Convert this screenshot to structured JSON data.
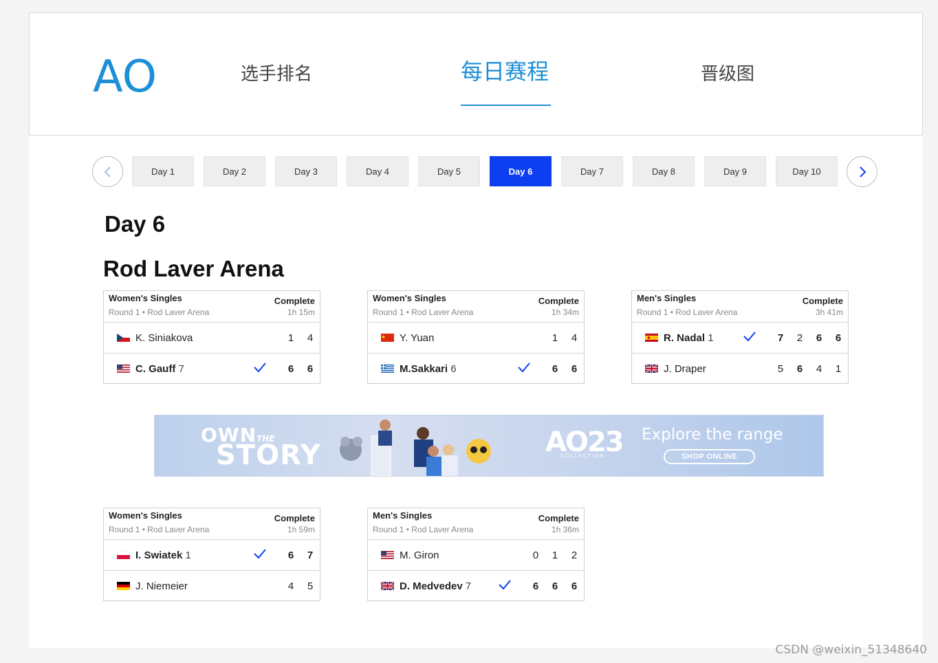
{
  "header": {
    "logo": "AO",
    "tabs": [
      {
        "label": "选手排名",
        "active": false
      },
      {
        "label": "每日赛程",
        "active": true
      },
      {
        "label": "晋级图",
        "active": false
      }
    ]
  },
  "days": {
    "selected": "Day 6",
    "items": [
      "Day 1",
      "Day 2",
      "Day 3",
      "Day 4",
      "Day 5",
      "Day 6",
      "Day 7",
      "Day 8",
      "Day 9",
      "Day 10"
    ]
  },
  "day_title": "Day 6",
  "arena_title": "Rod Laver Arena",
  "matches": [
    {
      "event": "Women's Singles",
      "round": "Round 1 • Rod Laver Arena",
      "status": "Complete",
      "duration": "1h 15m",
      "players": [
        {
          "name": "K. Siniakova",
          "seed": "",
          "flag": "cz",
          "winner": false,
          "scores": [
            "1",
            "4"
          ],
          "won": [
            false,
            false
          ]
        },
        {
          "name": "C. Gauff",
          "seed": "7",
          "flag": "us",
          "winner": true,
          "scores": [
            "6",
            "6"
          ],
          "won": [
            true,
            true
          ]
        }
      ]
    },
    {
      "event": "Women's Singles",
      "round": "Round 1 • Rod Laver Arena",
      "status": "Complete",
      "duration": "1h 34m",
      "players": [
        {
          "name": "Y. Yuan",
          "seed": "",
          "flag": "cn",
          "winner": false,
          "scores": [
            "1",
            "4"
          ],
          "won": [
            false,
            false
          ]
        },
        {
          "name": "M.Sakkari",
          "seed": "6",
          "flag": "gr",
          "winner": true,
          "scores": [
            "6",
            "6"
          ],
          "won": [
            true,
            true
          ]
        }
      ]
    },
    {
      "event": "Men's Singles",
      "round": "Round 1 • Rod Laver Arena",
      "status": "Complete",
      "duration": "3h 41m",
      "players": [
        {
          "name": "R. Nadal",
          "seed": "1",
          "flag": "es",
          "winner": true,
          "scores": [
            "7",
            "2",
            "6",
            "6"
          ],
          "won": [
            true,
            false,
            true,
            true
          ]
        },
        {
          "name": "J. Draper",
          "seed": "",
          "flag": "gb",
          "winner": false,
          "scores": [
            "5",
            "6",
            "4",
            "1"
          ],
          "won": [
            false,
            true,
            false,
            false
          ]
        }
      ]
    },
    {
      "event": "Women's Singles",
      "round": "Round 1 • Rod Laver Arena",
      "status": "Complete",
      "duration": "1h 59m",
      "players": [
        {
          "name": "I. Swiatek",
          "seed": "1",
          "flag": "pl",
          "winner": true,
          "scores": [
            "6",
            "7"
          ],
          "won": [
            true,
            true
          ]
        },
        {
          "name": "J. Niemeier",
          "seed": "",
          "flag": "de",
          "winner": false,
          "scores": [
            "4",
            "5"
          ],
          "won": [
            false,
            false
          ]
        }
      ]
    },
    {
      "event": "Men's Singles",
      "round": "Round 1 • Rod Laver Arena",
      "status": "Complete",
      "duration": "1h 36m",
      "players": [
        {
          "name": "M. Giron",
          "seed": "",
          "flag": "us",
          "winner": false,
          "scores": [
            "0",
            "1",
            "2"
          ],
          "won": [
            false,
            false,
            false
          ]
        },
        {
          "name": "D. Medvedev",
          "seed": "7",
          "flag": "gb",
          "winner": true,
          "scores": [
            "6",
            "6",
            "6"
          ],
          "won": [
            true,
            true,
            true
          ]
        }
      ]
    }
  ],
  "banner": {
    "own": "OWN",
    "the": "THE",
    "story": "STORY",
    "ao_logo": "AO23",
    "collection": "COLLECTION",
    "explore": "Explore the range",
    "shop": "SHOP ONLINE"
  },
  "watermark": "CSDN @weixin_51348640",
  "colors": {
    "accent": "#1d8fd6",
    "active_day": "#0d3ef0",
    "check": "#0d3ef0"
  }
}
